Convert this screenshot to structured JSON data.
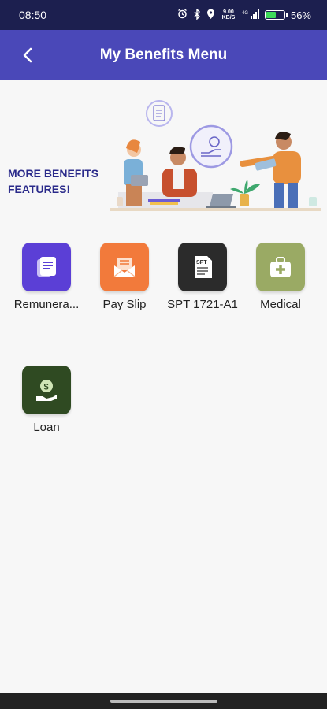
{
  "status_bar": {
    "time": "08:50",
    "battery": "56%",
    "battery_level": 0.56,
    "icons": [
      "alarm-icon",
      "bluetooth-icon",
      "location-icon",
      "data-speed-icon",
      "signal-icon",
      "battery-icon"
    ],
    "data_speed": "9.00 KB/S"
  },
  "app_bar": {
    "title": "My Benefits Menu",
    "back_icon": "back-arrow-icon"
  },
  "banner": {
    "text_line1": "MORE BENEFITS",
    "text_line2": "FEATURES!"
  },
  "menu": [
    {
      "label": "Remunera...",
      "icon": "document-stack-icon",
      "color": "#5b3fd6"
    },
    {
      "label": "Pay Slip",
      "icon": "envelope-icon",
      "color": "#f27a3b"
    },
    {
      "label": "SPT 1721-A1",
      "icon": "spt-form-icon",
      "color": "#2b2b2b",
      "icon_text": "SPT"
    },
    {
      "label": "Medical",
      "icon": "medical-kit-icon",
      "color": "#9aaa64"
    },
    {
      "label": "Loan",
      "icon": "money-hand-icon",
      "color": "#2f4a22"
    }
  ],
  "colors": {
    "status_bar": "#1c1f4f",
    "app_bar": "#4a48b8",
    "background": "#f7f7f7",
    "banner_text": "#2a2a8a"
  }
}
